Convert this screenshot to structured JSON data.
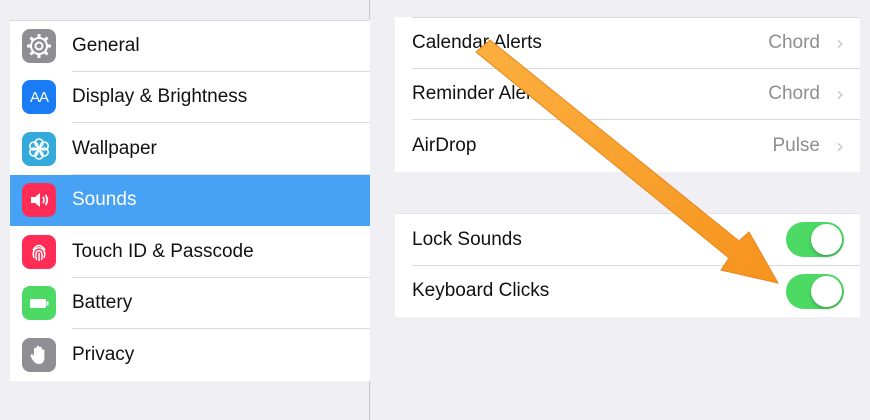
{
  "sidebar": {
    "items": [
      {
        "label": "General",
        "icon": "gear-icon",
        "color": "#8e8e93"
      },
      {
        "label": "Display & Brightness",
        "icon": "text-size-icon",
        "color": "#1a7cf5"
      },
      {
        "label": "Wallpaper",
        "icon": "flower-icon",
        "color": "#34aadc"
      },
      {
        "label": "Sounds",
        "icon": "speaker-icon",
        "color": "#ff2d55"
      },
      {
        "label": "Touch ID & Passcode",
        "icon": "fingerprint-icon",
        "color": "#ff2d55"
      },
      {
        "label": "Battery",
        "icon": "battery-icon",
        "color": "#4cd964"
      },
      {
        "label": "Privacy",
        "icon": "hand-icon",
        "color": "#8e8e93"
      }
    ],
    "selected_index": 3,
    "selected_color": "#47a1f5"
  },
  "alerts": {
    "rows": [
      {
        "label": "Calendar Alerts",
        "value": "Chord"
      },
      {
        "label": "Reminder Alerts",
        "value": "Chord"
      },
      {
        "label": "AirDrop",
        "value": "Pulse"
      }
    ]
  },
  "toggles": {
    "rows": [
      {
        "label": "Lock Sounds",
        "on": true
      },
      {
        "label": "Keyboard Clicks",
        "on": true
      }
    ],
    "on_color": "#4cd964"
  },
  "annotation": {
    "arrow_color": "#f7931e"
  },
  "icons": {
    "text_size_glyph": "AA"
  }
}
